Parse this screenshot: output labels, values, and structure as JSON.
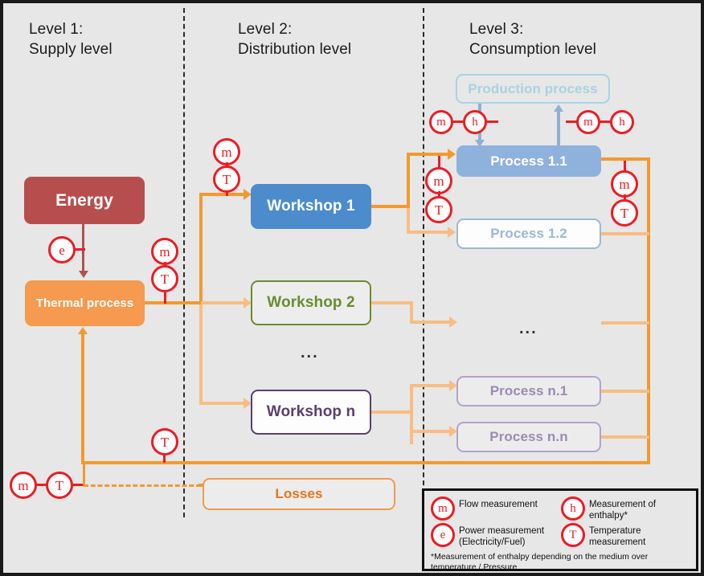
{
  "levels": [
    {
      "id": "level1",
      "heading": "Level 1:\nSupply level"
    },
    {
      "id": "level2",
      "heading": "Level 2:\nDistribution level"
    },
    {
      "id": "level3",
      "heading": "Level 3:\nConsumption level"
    }
  ],
  "nodes": {
    "energy": "Energy",
    "thermal_process": "Thermal process",
    "workshop1": "Workshop 1",
    "workshop2": "Workshop 2",
    "workshopn": "Workshop n",
    "production_process": "Production process",
    "process11": "Process 1.1",
    "process12": "Process 1.2",
    "processn1": "Process n.1",
    "processnn": "Process n.n",
    "losses": "Losses"
  },
  "ellipsis": "...",
  "measurements": {
    "m": "m",
    "t": "T",
    "e": "e",
    "h": "h"
  },
  "legend": {
    "items": [
      {
        "symbol": "m",
        "label": "Flow measurement"
      },
      {
        "symbol": "h",
        "label": "Measurement of enthalpy*"
      },
      {
        "symbol": "e",
        "label": "Power measurement\n(Electricity/Fuel)"
      },
      {
        "symbol": "T",
        "label": "Temperature measurement"
      }
    ],
    "note": "*Measurement of enthalpy depending on the medium over temperature / Pressure"
  },
  "colors": {
    "background": "#e7e7e7",
    "frame_border": "#1a1a1a",
    "energy": "#b74e4e",
    "thermal": "#f59a4e",
    "workshop1": "#4c8ccd",
    "workshop2": "#6c8b30",
    "workshopn": "#59406e",
    "process_blue": "#8fb2dd",
    "process_purple": "#b3a2cc",
    "production_process": "#a8d3e2",
    "pipe_orange": "#f3992f",
    "pipe_orange_light": "#f9bc82",
    "measurement_red": "#ec1c24",
    "losses": "#e8751a"
  }
}
